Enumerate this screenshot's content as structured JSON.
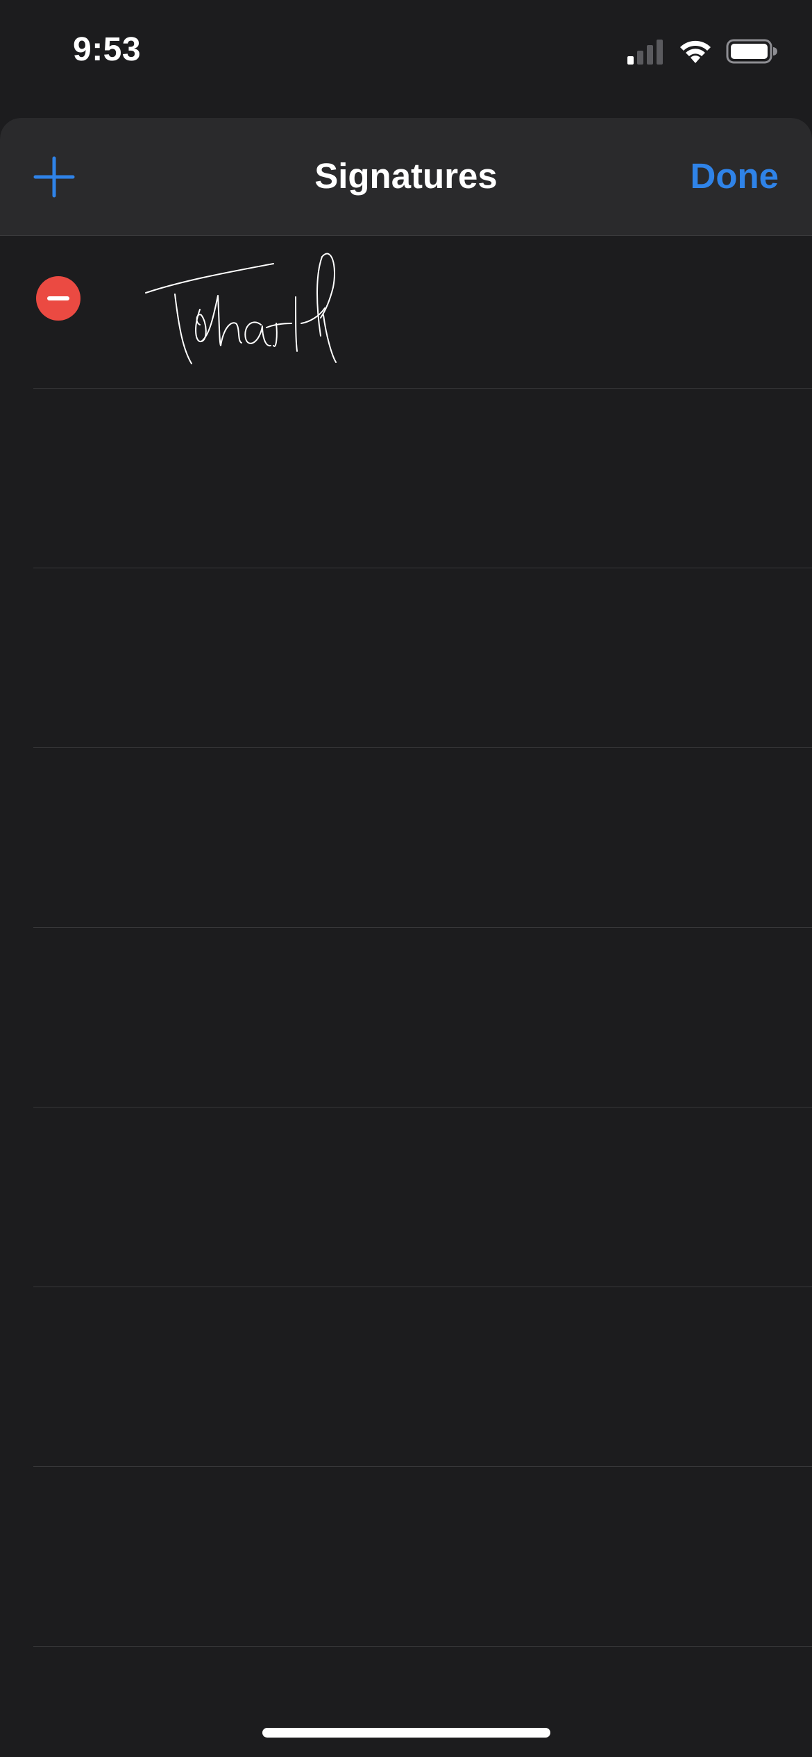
{
  "status_bar": {
    "time": "9:53",
    "icons": [
      "cellular-signal-icon",
      "wifi-icon",
      "battery-icon"
    ]
  },
  "nav": {
    "title": "Signatures",
    "done_label": "Done",
    "add_icon": "plus-icon"
  },
  "signatures": [
    {
      "name": "Tolha H",
      "delete_icon": "minus-circle-icon"
    }
  ],
  "colors": {
    "background": "#1c1c1e",
    "nav_background": "#2a2a2c",
    "accent": "#2f83e8",
    "destructive": "#eb4a42",
    "separator": "#38383a"
  }
}
